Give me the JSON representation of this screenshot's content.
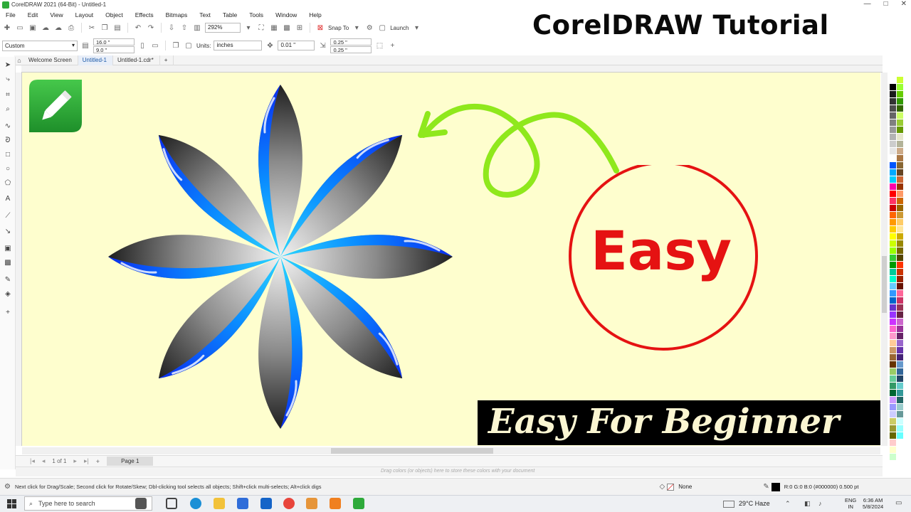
{
  "window": {
    "title": "CorelDRAW 2021 (64-Bit) - Untitled-1",
    "controls": [
      "—",
      "□",
      "✕"
    ]
  },
  "menu": [
    "File",
    "Edit",
    "View",
    "Layout",
    "Object",
    "Effects",
    "Bitmaps",
    "Text",
    "Table",
    "Tools",
    "Window",
    "Help"
  ],
  "toolbar": {
    "zoom": "292%",
    "snap_label": "Snap To",
    "launch_label": "Launch"
  },
  "property_bar": {
    "page_preset": "Custom",
    "width": "16.0 \"",
    "height": "9.0 \"",
    "units_label": "Units:",
    "units_value": "inches",
    "nudge": "0.01 \"",
    "dup_x": "0.25 \"",
    "dup_y": "0.25 \""
  },
  "tabs": [
    "Welcome Screen",
    "Untitled-1",
    "Untitled-1.cdr*"
  ],
  "overlay": {
    "title": "CorelDRAW Tutorial",
    "circle_word": "Easy",
    "banner": "Easy For Beginner"
  },
  "colors": {
    "canvas": "#fefece",
    "petal_blue": "#0a3cff",
    "arrow_green": "#8fe81c",
    "circle_red": "#e51212",
    "title": "#0a0a0a",
    "banner_bg": "#000000",
    "banner_text": "#fbf6d2"
  },
  "page_nav": {
    "counter": "1 of 1",
    "page_tab": "Page 1"
  },
  "colorbar_hint": "Drag colors (or objects) here to store these colors with your document",
  "status": {
    "hint": "Next click for Drag/Scale; Second click for Rotate/Skew; Dbl-clicking tool selects all objects; Shift+click multi-selects; Alt+click digs",
    "fill": "None",
    "outline": "R:0 G:0 B:0 (#000000)  0.500 pt"
  },
  "taskbar": {
    "search_placeholder": "Type here to search",
    "weather": "29°C  Haze",
    "lang": "ENG",
    "region": "IN",
    "time": "6:36 AM",
    "date": "5/8/2024"
  }
}
